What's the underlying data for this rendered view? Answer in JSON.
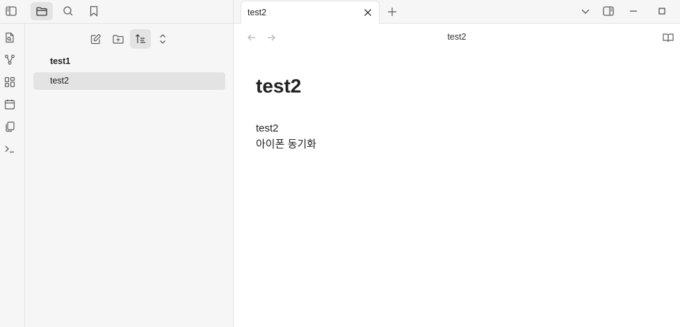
{
  "sidebar": {
    "files": [
      {
        "name": "test1"
      },
      {
        "name": "test2"
      }
    ]
  },
  "tabs": [
    {
      "title": "test2"
    }
  ],
  "view": {
    "title": "test2"
  },
  "document": {
    "heading": "test2",
    "lines": [
      "test2",
      "아이폰 동기화"
    ]
  },
  "icons": {
    "left_header": [
      "sidebar-toggle-icon",
      "folder-icon",
      "search-icon",
      "bookmark-icon"
    ],
    "nav": [
      "new-note-icon",
      "new-folder-icon",
      "sort-icon",
      "collapse-icon"
    ],
    "ribbon": [
      "quick-switcher-icon",
      "graph-icon",
      "canvas-icon",
      "calendar-icon",
      "templates-icon",
      "terminal-icon"
    ],
    "window": [
      "chevron-down-icon",
      "right-sidebar-toggle-icon",
      "minimize-icon",
      "maximize-icon"
    ]
  },
  "colors": {
    "panel_bg": "#f6f6f6",
    "active_bg": "#e3e3e3",
    "border": "#e3e3e3",
    "icon": "#5c5c5c"
  }
}
